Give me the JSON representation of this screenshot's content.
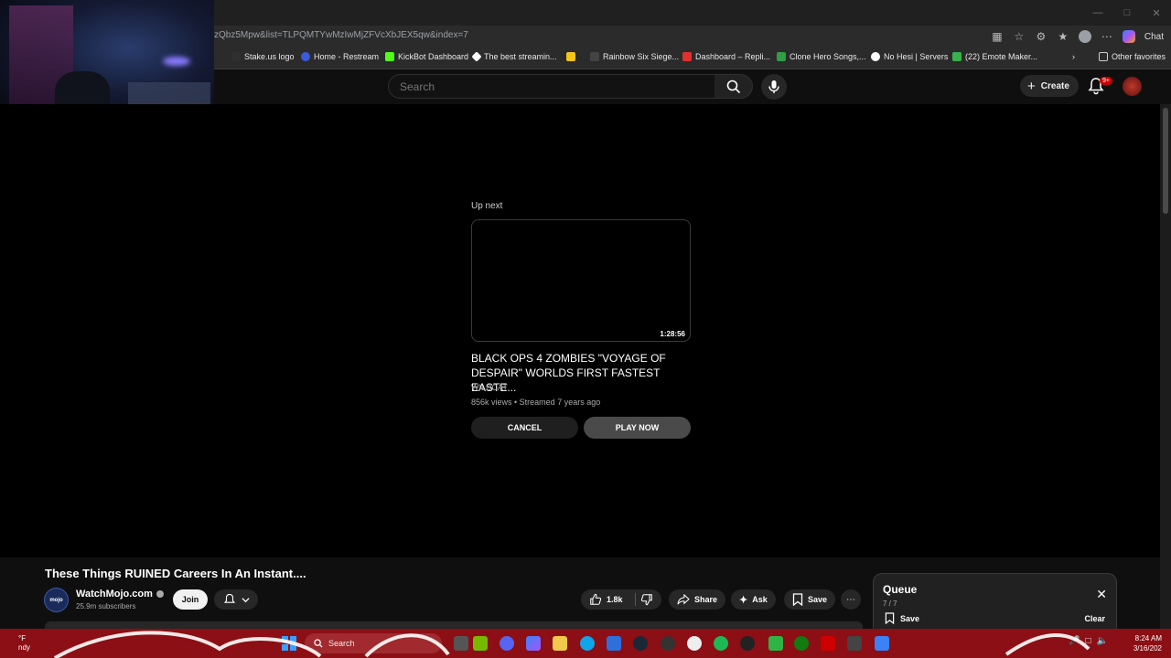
{
  "browser": {
    "url_fragment": "zQbz5Mpw&list=TLPQMTYwMzIwMjZFVcXbJEX5qw&index=7",
    "chat_label": "Chat",
    "bookmarks": [
      {
        "label": "Stake.us logo",
        "color": "#2f2f2f"
      },
      {
        "label": "Home - Restream",
        "color": "#3b5bdb"
      },
      {
        "label": "KickBot Dashboard",
        "color": "#53fc18"
      },
      {
        "label": "The best streamin...",
        "color": "#ffffff"
      },
      {
        "label": "",
        "color": "#f5c518"
      },
      {
        "label": "Rainbow Six Siege...",
        "color": "#444444"
      },
      {
        "label": "Dashboard – Repli...",
        "color": "#e03131"
      },
      {
        "label": "Clone Hero Songs,...",
        "color": "#2f9e44"
      },
      {
        "label": "No Hesi | Servers",
        "color": "#ffffff"
      },
      {
        "label": "(22) Emote Maker...",
        "color": "#37b24d"
      }
    ],
    "other_favorites": "Other favorites"
  },
  "youtube": {
    "search_placeholder": "Search",
    "create_label": "Create",
    "notif_badge": "9+"
  },
  "up_next": {
    "label": "Up next",
    "duration": "1:28:56",
    "title": "BLACK OPS 4 ZOMBIES \"VOYAGE OF DESPAIR\" WORLDS FIRST FASTEST EASTE...",
    "channel": "WILDCAT",
    "meta": "856k views • Streamed 7 years ago",
    "cancel": "CANCEL",
    "play_now": "PLAY NOW"
  },
  "video": {
    "title": "These Things RUINED Careers In An Instant....",
    "channel_name": "WatchMojo.com",
    "subscribers": "25.9m subscribers",
    "join": "Join",
    "likes": "1.8k",
    "share": "Share",
    "ask": "Ask",
    "save": "Save"
  },
  "queue": {
    "title": "Queue",
    "count": "7 / 7",
    "save": "Save",
    "clear": "Clear"
  },
  "taskbar": {
    "weather_temp": "°F",
    "weather_desc": "ndy",
    "search_label": "Search",
    "time": "8:24 AM",
    "date": "3/16/202"
  },
  "colors": {
    "taskbar_bg": "#8b0f14",
    "yt_bg": "#0f0f0f",
    "accent_red": "#cc0000"
  }
}
